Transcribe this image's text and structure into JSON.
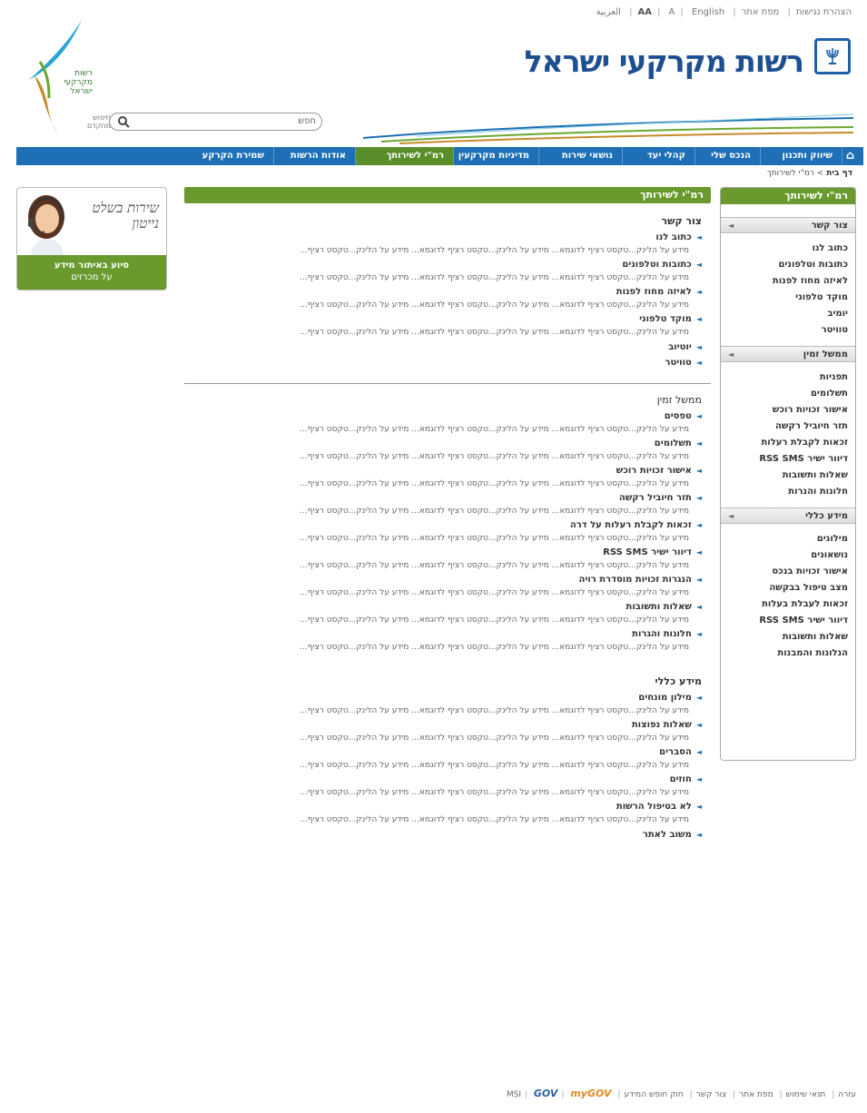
{
  "top_links": {
    "arabic": "العربية",
    "english": "English",
    "font_size_small": "A",
    "font_size_large": "AA",
    "site_map": "מפת אתר",
    "accessibility": "הצהרת נגישות"
  },
  "site": {
    "title": "רשות מקרקעי ישראל",
    "logo_text": "רשות מקרקעי ישראל"
  },
  "search": {
    "label": "חפש",
    "advanced": "חיפוש מתקדם"
  },
  "nav": {
    "items": [
      "שיווק ותכנון",
      "הנכס שלי",
      "קהלי יעד",
      "נושאי שירות",
      "מדיניות מקרקעין",
      "רמ\"י לשירותך",
      "אודות הרשות",
      "שמירת הקרקע"
    ]
  },
  "breadcrumb": {
    "home": "דף בית",
    "separator": ">",
    "current": "רמ\"י לשירותך"
  },
  "sidebar": {
    "title": "רמ\"י לשירותך",
    "groups": [
      {
        "heading": "צור קשר",
        "items": [
          "כתוב לנו",
          "כתובות וטלפונים",
          "לאיזה מחוז לפנות",
          "מוקד טלפוני",
          "יומיב",
          "טוויטר"
        ]
      },
      {
        "heading": "ממשל זמין",
        "items": [
          "תפניות",
          "תשלומים",
          "אישור זכויות רוכש",
          "תזר חיוביל רקשה",
          "זכאות לקבלת רעלות",
          "דיוור ישיר RSS SMS",
          "שאלות ותשובות",
          "חלונות והנרות"
        ]
      },
      {
        "heading": "מידע כללי",
        "items": [
          "מילונים",
          "נושאונים",
          "אישור זכויות בנכס",
          "מצב טיפול בבקשה",
          "זכאות לעבלת בעלות",
          "דיוור ישיר RSS SMS",
          "שאלות ותשובות",
          "הנלונות והמבנות"
        ]
      }
    ]
  },
  "promo": {
    "script_line1": "שירות בשלט",
    "script_line2": "נייטון",
    "bar_line1": "סיוע באיתור מידע",
    "bar_line2": "על מכרזים"
  },
  "main": {
    "header": "רמ\"י לשירותך",
    "desc_text": "מידע על הלינק...טקסט רציף לדוגמא... מידע על הלינק...טקסט רציף לדוגמא... מידע על הלינק...טקסט רציף...",
    "sections": [
      {
        "title": "צור קשר",
        "entries": [
          {
            "title": "כתוב לנו",
            "has_desc": true
          },
          {
            "title": "כתובות וטלפונים",
            "has_desc": true
          },
          {
            "title": "לאיזה מחוז לפנות",
            "has_desc": true
          },
          {
            "title": "מוקד טלפוני",
            "has_desc": true
          },
          {
            "title": "יוטיוב",
            "has_desc": false
          },
          {
            "title": "טוויטר",
            "has_desc": false
          }
        ]
      },
      {
        "title": "ממשל זמין",
        "entries": [
          {
            "title": "טפסים",
            "has_desc": true
          },
          {
            "title": "תשלומים",
            "has_desc": true
          },
          {
            "title": "אישור זכויות רוכש",
            "has_desc": true
          },
          {
            "title": "תזר חיוביל רקשה",
            "has_desc": true
          },
          {
            "title": "זכאות לקבלת רעלות על דרה",
            "has_desc": true
          },
          {
            "title": "דיוור ישיר RSS SMS",
            "has_desc": true
          },
          {
            "title": "הנגרות זכויות מוסדרת רויה",
            "has_desc": true
          },
          {
            "title": "שאלות ותשובות",
            "has_desc": true
          },
          {
            "title": "חלונות והגרות",
            "has_desc": true
          }
        ]
      },
      {
        "title": "מידע כללי",
        "entries": [
          {
            "title": "מילון מונחים",
            "has_desc": true
          },
          {
            "title": "שאלות נפוצות",
            "has_desc": true
          },
          {
            "title": "הסברים",
            "has_desc": true
          },
          {
            "title": "חוזים",
            "has_desc": true
          },
          {
            "title": "לא בטיפול הרשות",
            "has_desc": true
          },
          {
            "title": "משוב לאתר",
            "has_desc": false
          }
        ]
      }
    ]
  },
  "footer": {
    "links": [
      "עזרה",
      "תנאי שימוש",
      "מפת אתר",
      "צור קשר",
      "חוק חופש המידע",
      "MSI"
    ],
    "badge_gov": "GOV",
    "badge_mygov": "myGOV"
  },
  "colors": {
    "nav_blue": "#1e6fb5",
    "accent_green": "#6a9a2e",
    "title_blue": "#1d4f91"
  }
}
